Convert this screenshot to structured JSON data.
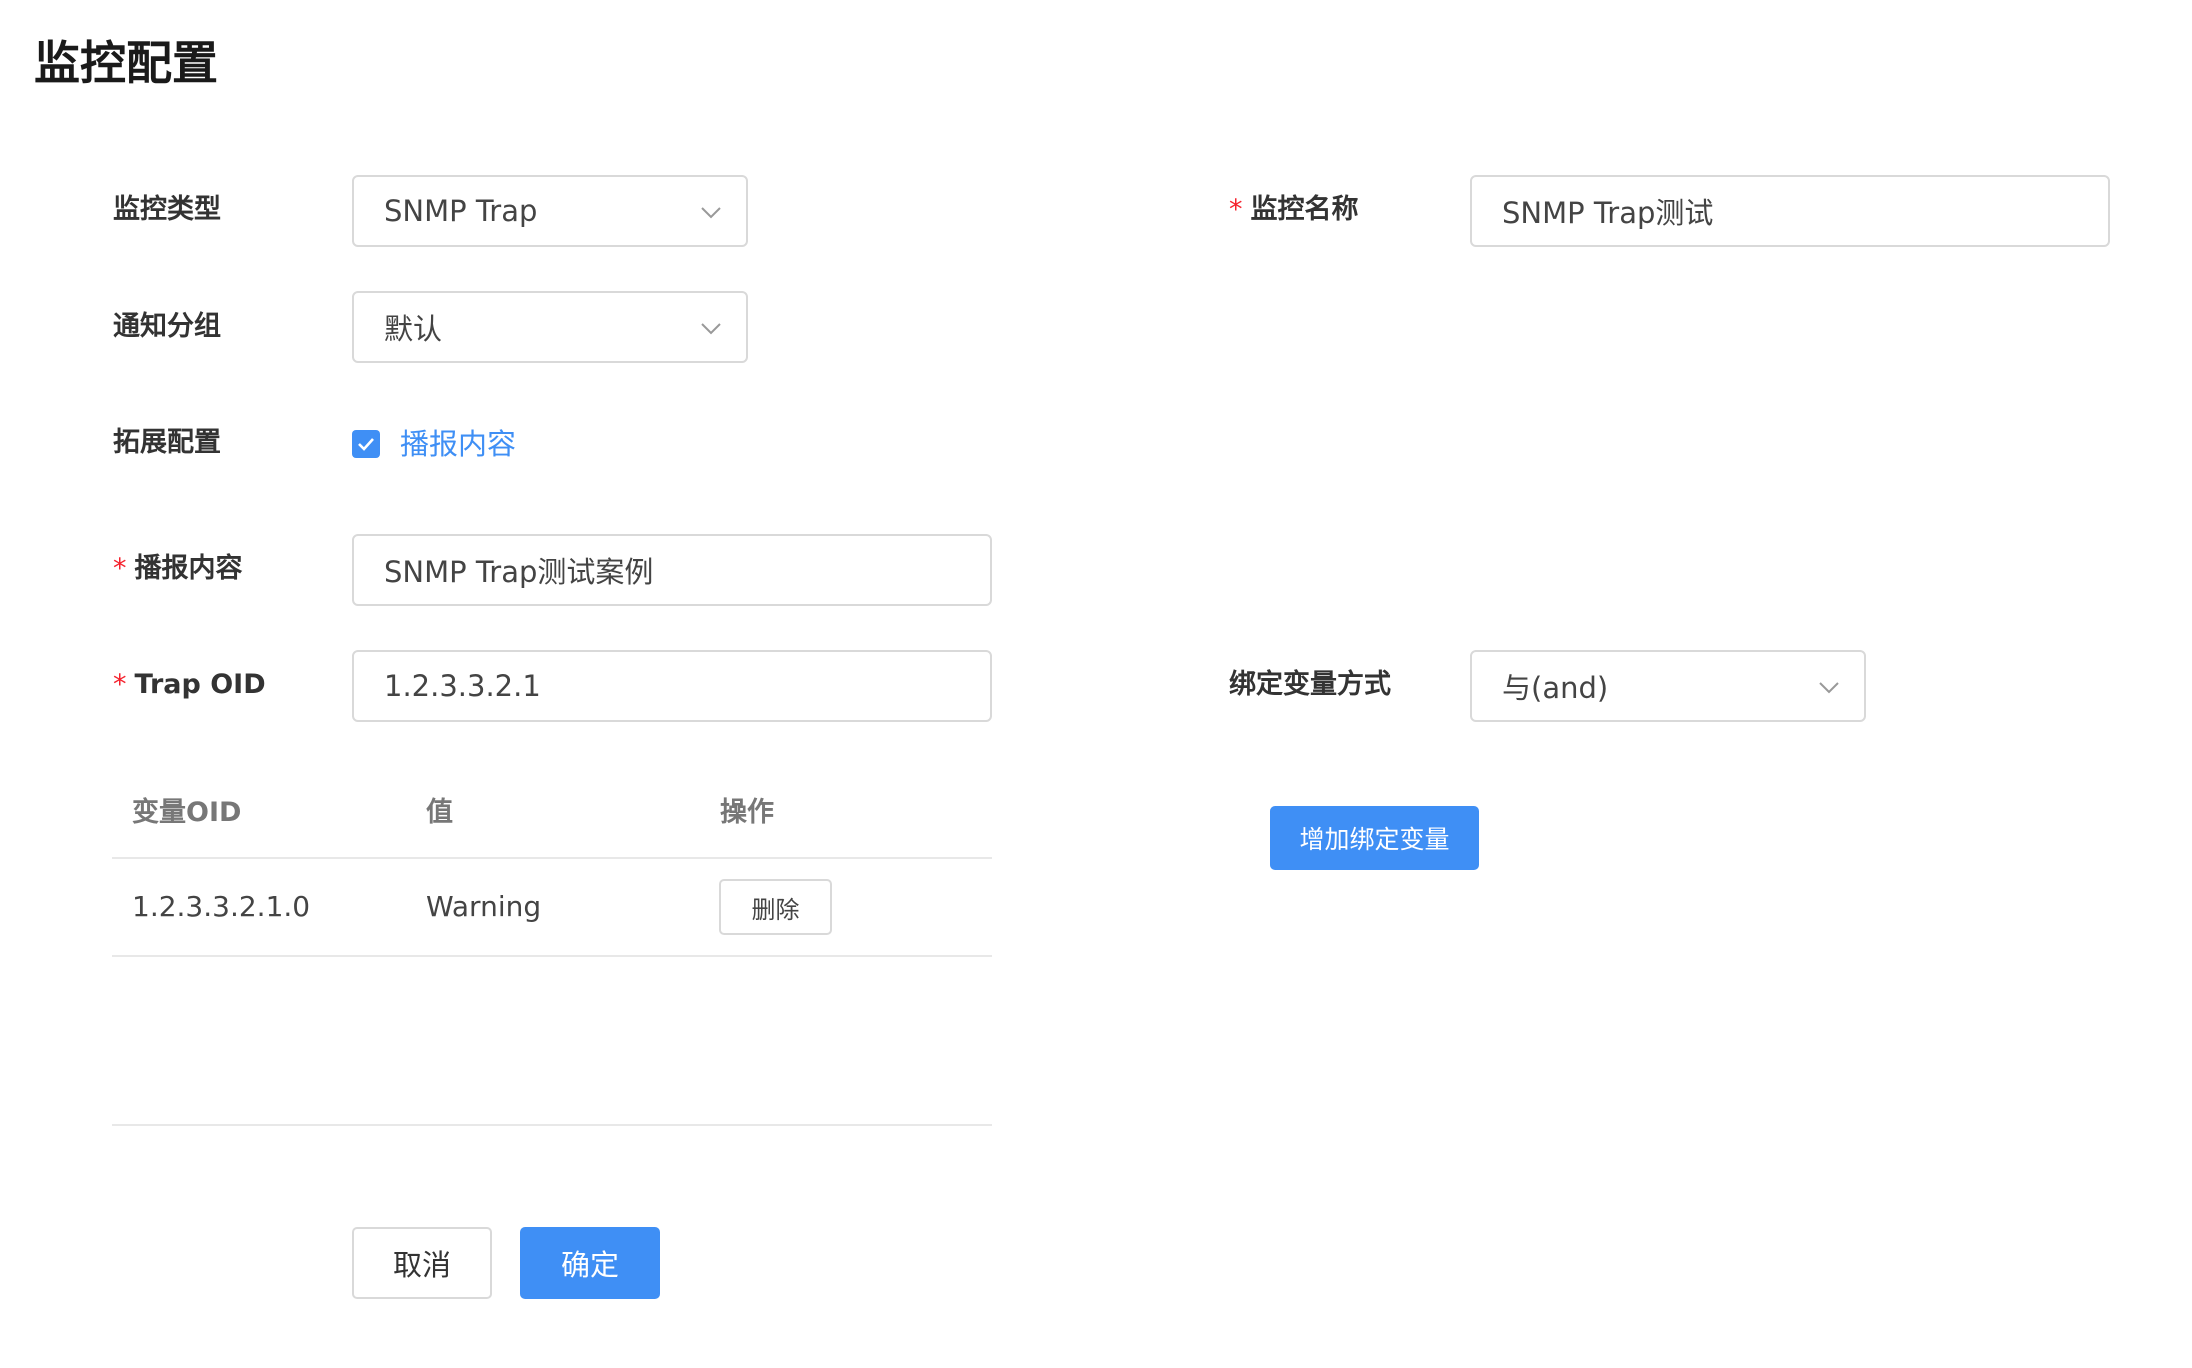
{
  "page": {
    "title": "监控配置"
  },
  "form": {
    "monitor_type": {
      "label": "监控类型",
      "value": "SNMP Trap"
    },
    "monitor_name": {
      "required_mark": "*",
      "label": "监控名称",
      "value": "SNMP Trap测试"
    },
    "notify_group": {
      "label": "通知分组",
      "value": "默认"
    },
    "extension": {
      "label": "拓展配置",
      "checkbox_label": "播报内容",
      "checked": true
    },
    "broadcast": {
      "required_mark": "*",
      "label": "播报内容",
      "value": "SNMP Trap测试案例"
    },
    "trap_oid": {
      "required_mark": "*",
      "label": "Trap OID",
      "value": "1.2.3.3.2.1"
    },
    "bind_mode": {
      "label": "绑定变量方式",
      "value": "与(and)"
    }
  },
  "var_table": {
    "headers": [
      "变量OID",
      "值",
      "操作"
    ],
    "rows": [
      {
        "oid": "1.2.3.3.2.1.0",
        "value": "Warning",
        "action_label": "删除"
      }
    ]
  },
  "add_var_button": "增加绑定变量",
  "footer": {
    "cancel_label": "取消",
    "confirm_label": "确定"
  },
  "colors": {
    "primary": "#3f8ff5",
    "required": "#f5222d",
    "border": "#d9d9d9"
  },
  "icons": {
    "select_arrow": "chevron-down-icon",
    "checkbox_mark": "checkmark-icon"
  }
}
